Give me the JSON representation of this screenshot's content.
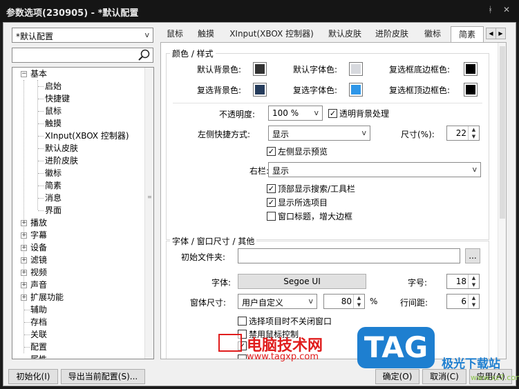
{
  "window": {
    "title": "参数选项(230905) - *默认配置",
    "pin_glyph": "ᚼ",
    "close_glyph": "✕"
  },
  "profile": {
    "value": "*默认配置"
  },
  "search": {
    "value": ""
  },
  "tree": {
    "root_basic": "基本",
    "basic_children": [
      "启始",
      "快捷键",
      "鼠标",
      "触摸",
      "XInput(XBOX 控制器)",
      "默认皮肤",
      "进阶皮肤",
      "徽标",
      "简素",
      "消息",
      "界面"
    ],
    "collapsed": [
      "播放",
      "字幕",
      "设备",
      "滤镜",
      "视频",
      "声音",
      "扩展功能"
    ],
    "leaves": [
      "辅助",
      "存档",
      "关联",
      "配置",
      "属性"
    ]
  },
  "tabs": [
    "鼠标",
    "触摸",
    "XInput(XBOX 控制器)",
    "默认皮肤",
    "进阶皮肤",
    "徽标",
    "简素"
  ],
  "tab_active": "简素",
  "colors_group": {
    "title": "颜色 / 样式",
    "items": [
      {
        "label": "默认背景色:",
        "color": "#333333"
      },
      {
        "label": "默认字体色:",
        "color": "#d7d9de"
      },
      {
        "label": "复选框底边框色:",
        "color": "#000000"
      },
      {
        "label": "复选背景色:",
        "color": "#253c5c"
      },
      {
        "label": "复选字体色:",
        "color": "#2e96e8"
      },
      {
        "label": "复选框顶边框色:",
        "color": "#000000"
      }
    ]
  },
  "opacity": {
    "label": "不透明度:",
    "value": "100 %",
    "checkbox": "透明背景处理",
    "checked": true
  },
  "left_mode": {
    "label": "左侧快捷方式:",
    "value": "显示",
    "size_label": "尺寸(%):",
    "size_value": "22"
  },
  "left_preview": {
    "label": "左侧显示预览",
    "checked": true
  },
  "right_bar": {
    "label": "右栏:",
    "value": "显示"
  },
  "opts": [
    {
      "label": "顶部显示搜索/工具栏",
      "checked": true
    },
    {
      "label": "显示所选项目",
      "checked": true
    },
    {
      "label": "窗口标题，增大边框",
      "checked": false
    }
  ],
  "font_group": {
    "title": "字体 / 窗口尺寸 / 其他",
    "init_folder_label": "初始文件夹:",
    "init_folder_value": "",
    "browse_label": "...",
    "font_label": "字体:",
    "font_value": "Segoe UI",
    "font_size_label": "字号:",
    "font_size_value": "18",
    "win_size_label": "窗体尺寸:",
    "win_size_value": "用户自定义",
    "win_size_pct": "80",
    "pct_sign": "%",
    "line_gap_label": "行间距:",
    "line_gap_value": "6",
    "checks": [
      {
        "label": "选择项目时不关闭窗口",
        "checked": false
      },
      {
        "label": "禁用鼠标控制",
        "checked": false
      },
      {
        "label": "",
        "checked": true
      },
      {
        "label": "",
        "checked": false
      }
    ]
  },
  "footer": {
    "init": "初始化(I)",
    "export": "导出当前配置(S)...",
    "ok": "确定(O)",
    "cancel": "取消(C)",
    "apply": "应用(A)"
  },
  "watermark": {
    "tag": "TAG",
    "brand": "电脑技术网",
    "url": "www.tagxp.com",
    "site": "极光下载站",
    "site_url": "www.xz7.com"
  }
}
